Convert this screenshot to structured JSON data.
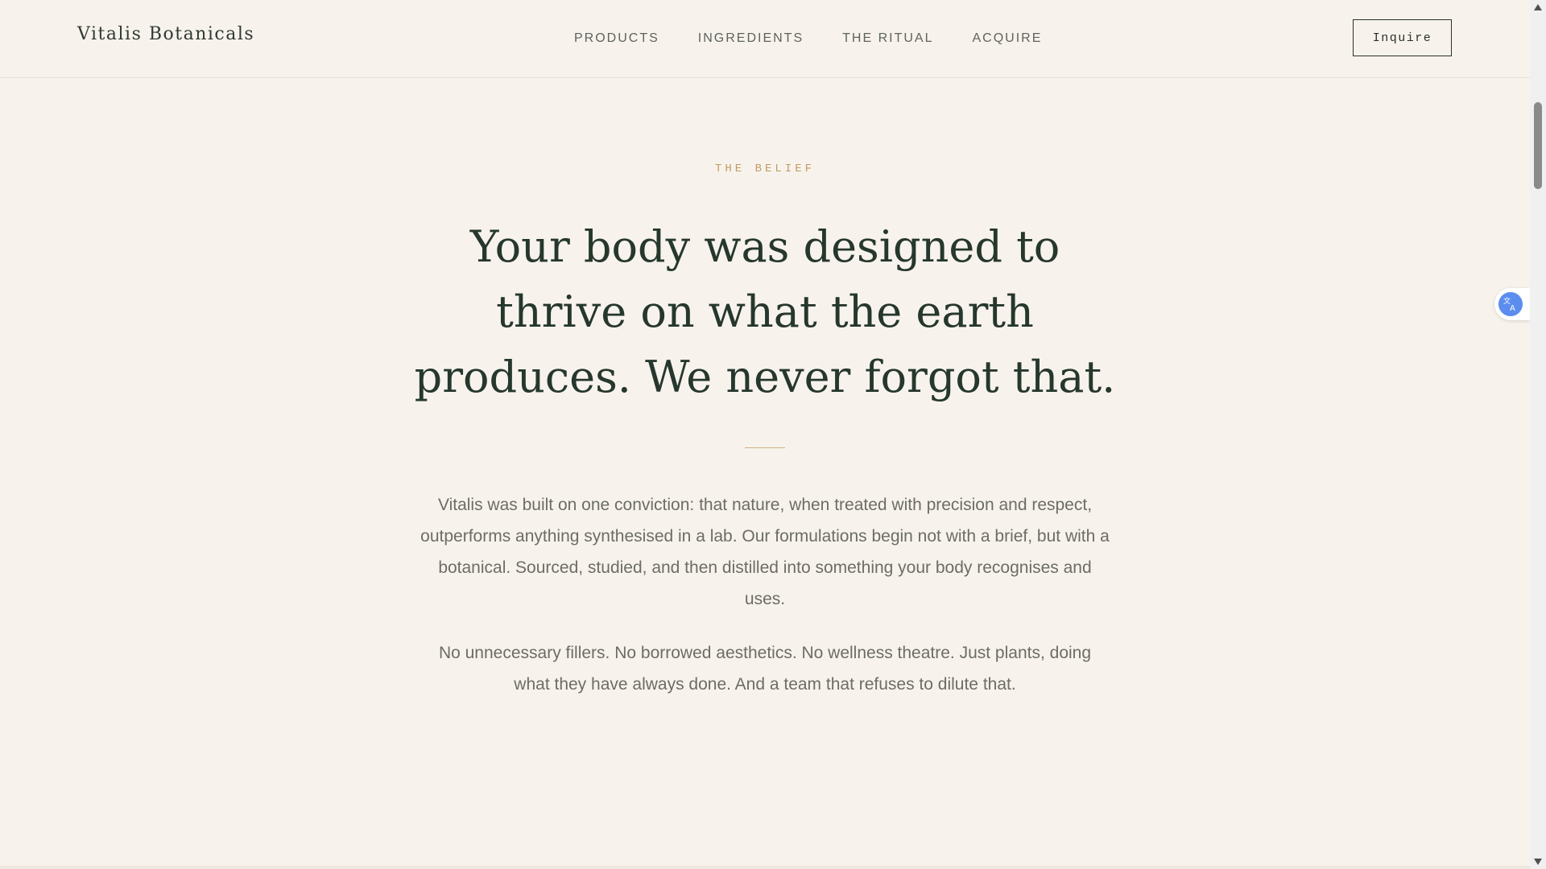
{
  "header": {
    "brand": "Vitalis Botanicals",
    "nav": [
      {
        "label": "PRODUCTS"
      },
      {
        "label": "INGREDIENTS"
      },
      {
        "label": "THE RITUAL"
      },
      {
        "label": "ACQUIRE"
      }
    ],
    "cta_label": "Inquire"
  },
  "section": {
    "eyebrow": "THE BELIEF",
    "headline": "Your body was designed to thrive on what the earth produces. We never forgot that.",
    "paragraph_1": "Vitalis was built on one conviction: that nature, when treated with precision and respect, outperforms anything synthesised in a lab. Our formulations begin not with a brief, but with a botanical. Sourced, studied, and then distilled into something your body recognises and uses.",
    "paragraph_2": "No unnecessary fillers. No borrowed aesthetics. No wellness theatre. Just plants, doing what they have always done. And a team that refuses to dilute that."
  },
  "widgets": {
    "translate_icon": "translate-icon"
  },
  "colors": {
    "background": "#f7f3ec",
    "headline": "#26372d",
    "eyebrow_accent": "#c39a62",
    "body_text": "#6c6c66",
    "translate_blue": "#5b8def"
  }
}
